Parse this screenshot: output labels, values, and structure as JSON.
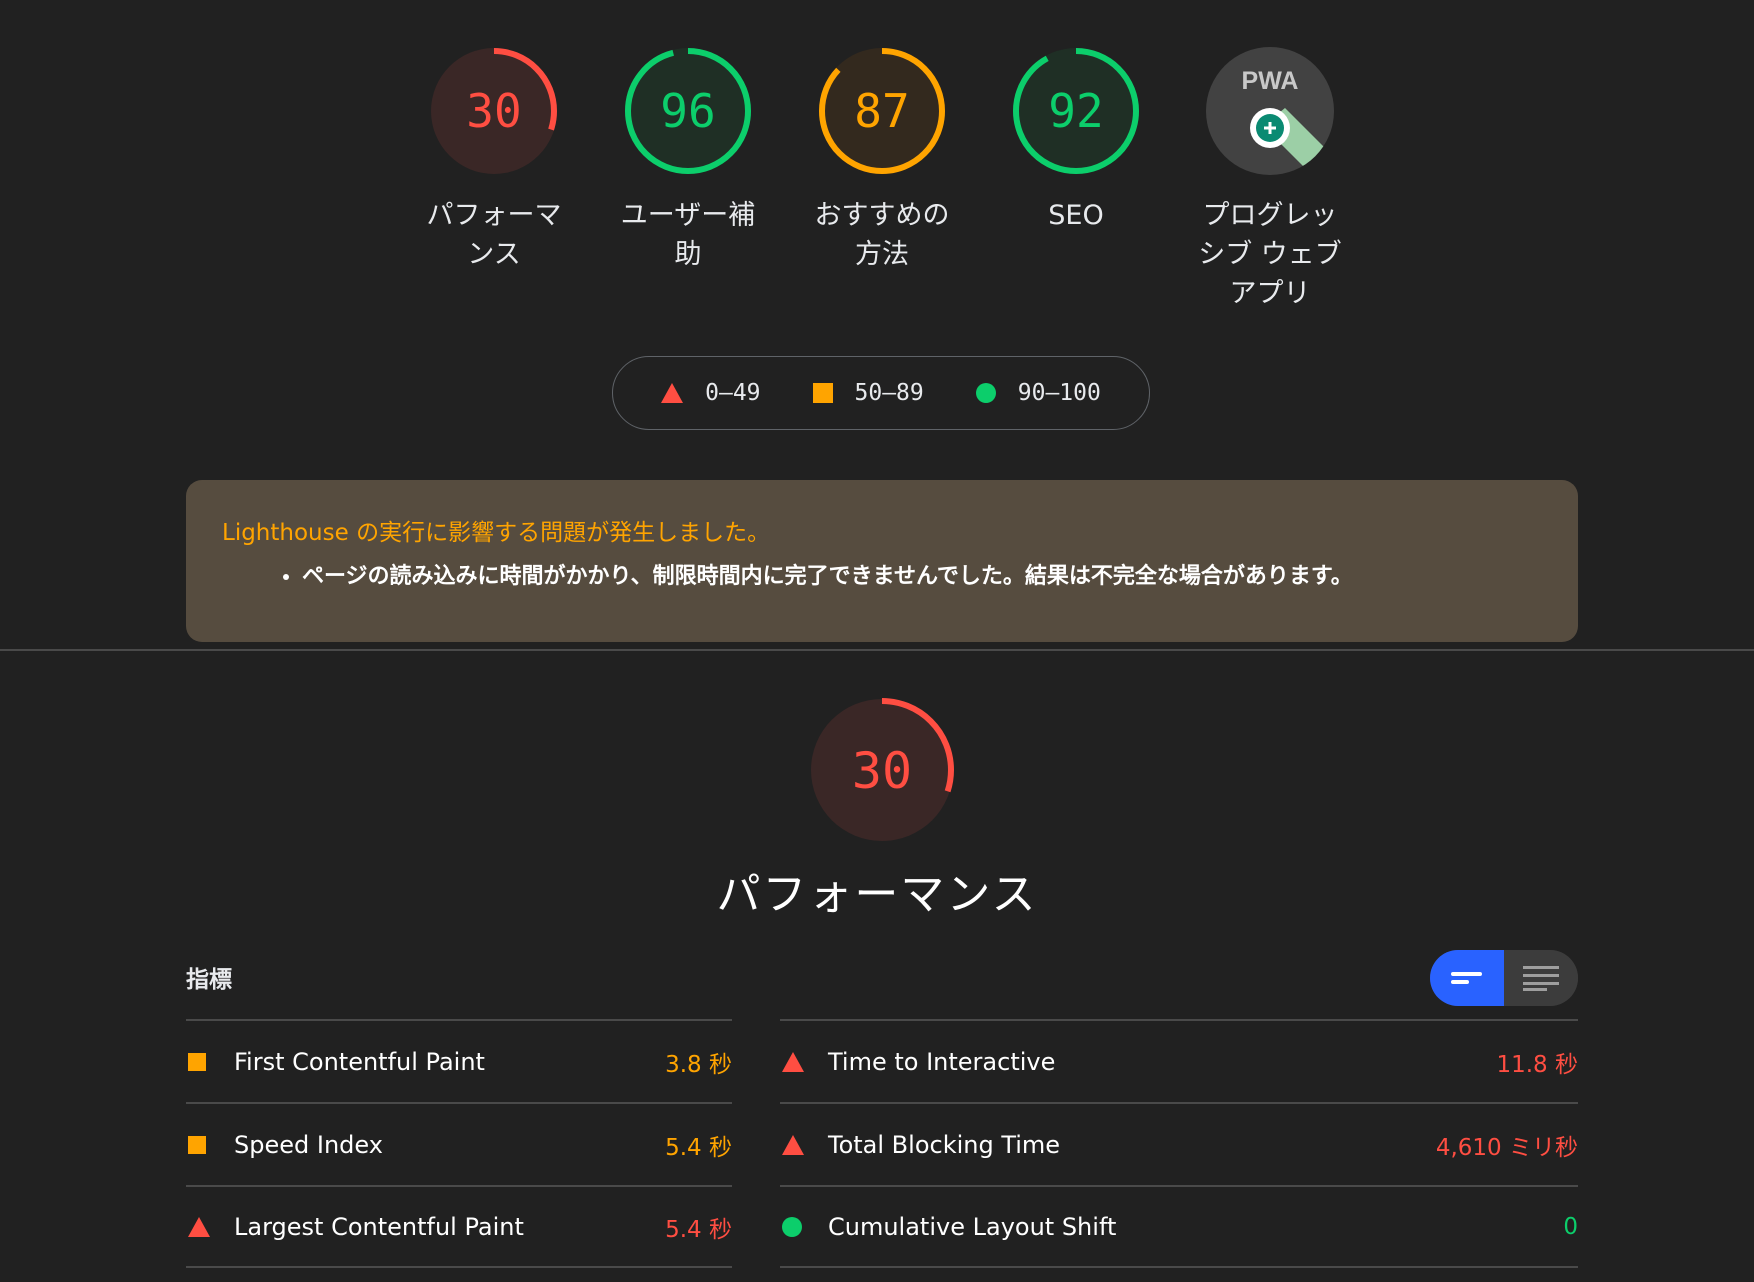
{
  "colors": {
    "fail": "#ff4e42",
    "average": "#ffa400",
    "pass": "#0cce6b",
    "accent_toggle": "#2962ff"
  },
  "gauges": [
    {
      "score": "30",
      "label": "パフォーマンス",
      "rating": "fail",
      "fraction": 0.3
    },
    {
      "score": "96",
      "label": "ユーザー補助",
      "rating": "pass",
      "fraction": 0.96
    },
    {
      "score": "87",
      "label": "おすすめの方法",
      "rating": "average",
      "fraction": 0.87
    },
    {
      "score": "92",
      "label": "SEO",
      "rating": "pass",
      "fraction": 0.92
    },
    {
      "badge": "PWA",
      "label": "プログレッシブ ウェブ アプリ",
      "rating": "pwa"
    }
  ],
  "legend": [
    {
      "shape": "triangle",
      "text": "0–49"
    },
    {
      "shape": "square",
      "text": "50–89"
    },
    {
      "shape": "circle",
      "text": "90–100"
    }
  ],
  "warning": {
    "title": "Lighthouse の実行に影響する問題が発生しました。",
    "items": [
      "ページの読み込みに時間がかかり、制限時間内に完了できませんでした。結果は不完全な場合があります。"
    ]
  },
  "performance": {
    "score": "30",
    "fraction": 0.3,
    "title": "パフォーマンス"
  },
  "metrics": {
    "heading": "指標",
    "left": [
      {
        "name": "First Contentful Paint",
        "value": "3.8 秒",
        "rating": "average"
      },
      {
        "name": "Speed Index",
        "value": "5.4 秒",
        "rating": "average"
      },
      {
        "name": "Largest Contentful Paint",
        "value": "5.4 秒",
        "rating": "fail"
      }
    ],
    "right": [
      {
        "name": "Time to Interactive",
        "value": "11.8 秒",
        "rating": "fail"
      },
      {
        "name": "Total Blocking Time",
        "value": "4,610 ミリ秒",
        "rating": "fail"
      },
      {
        "name": "Cumulative Layout Shift",
        "value": "0",
        "rating": "pass"
      }
    ]
  },
  "icons": {
    "toggle_compact": "list-compact-icon",
    "toggle_expanded": "list-expanded-icon",
    "pwa": "pwa-badge-icon"
  }
}
